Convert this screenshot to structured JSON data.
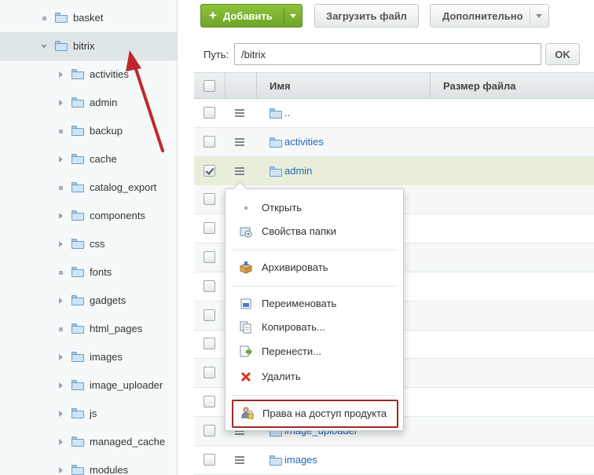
{
  "tree": {
    "items": [
      {
        "label": "basket",
        "control": "dot",
        "indent": 0,
        "selected": false
      },
      {
        "label": "bitrix",
        "control": "expanded",
        "indent": 0,
        "selected": true
      },
      {
        "label": "activities",
        "control": "collapsed",
        "indent": 1,
        "selected": false
      },
      {
        "label": "admin",
        "control": "collapsed",
        "indent": 1,
        "selected": false
      },
      {
        "label": "backup",
        "control": "dot",
        "indent": 1,
        "selected": false
      },
      {
        "label": "cache",
        "control": "collapsed",
        "indent": 1,
        "selected": false
      },
      {
        "label": "catalog_export",
        "control": "dot",
        "indent": 1,
        "selected": false
      },
      {
        "label": "components",
        "control": "collapsed",
        "indent": 1,
        "selected": false
      },
      {
        "label": "css",
        "control": "collapsed",
        "indent": 1,
        "selected": false
      },
      {
        "label": "fonts",
        "control": "dot",
        "indent": 1,
        "selected": false
      },
      {
        "label": "gadgets",
        "control": "collapsed",
        "indent": 1,
        "selected": false
      },
      {
        "label": "html_pages",
        "control": "dot",
        "indent": 1,
        "selected": false
      },
      {
        "label": "images",
        "control": "collapsed",
        "indent": 1,
        "selected": false
      },
      {
        "label": "image_uploader",
        "control": "collapsed",
        "indent": 1,
        "selected": false
      },
      {
        "label": "js",
        "control": "collapsed",
        "indent": 1,
        "selected": false
      },
      {
        "label": "managed_cache",
        "control": "collapsed",
        "indent": 1,
        "selected": false
      },
      {
        "label": "modules",
        "control": "collapsed",
        "indent": 1,
        "selected": false
      }
    ]
  },
  "toolbar": {
    "add_label": "Добавить",
    "upload_label": "Загрузить файл",
    "more_label": "Дополнительно",
    "path_label": "Путь:",
    "path_value": "/bitrix",
    "ok_label": "OK"
  },
  "grid": {
    "col_name": "Имя",
    "col_size": "Размер файла",
    "rows": [
      {
        "name": "..",
        "checked": false,
        "parent": true
      },
      {
        "name": "activities",
        "checked": false
      },
      {
        "name": "admin",
        "checked": true,
        "selected": true
      },
      {
        "name": "",
        "checked": false
      },
      {
        "name": "",
        "checked": false
      },
      {
        "name": "",
        "checked": false
      },
      {
        "name": "",
        "checked": false
      },
      {
        "name": "",
        "checked": false
      },
      {
        "name": "",
        "checked": false
      },
      {
        "name": "",
        "checked": false
      },
      {
        "name": "",
        "checked": false
      },
      {
        "name": "image_uploader",
        "checked": false
      },
      {
        "name": "images",
        "checked": false
      }
    ]
  },
  "context_menu": {
    "open": "Открыть",
    "folder_properties": "Свойства папки",
    "archive": "Архивировать",
    "rename": "Переименовать",
    "copy": "Копировать...",
    "move": "Перенести...",
    "delete": "Удалить",
    "access_rights": "Права на доступ продукта"
  },
  "colors": {
    "add_button": "#7ab432",
    "link": "#2067b0",
    "highlight_border": "#9c2a2a",
    "arrow": "#c0272d"
  },
  "icons": {
    "open": "bullet-icon",
    "folder_properties": "folder-properties-icon",
    "archive": "archive-box-icon",
    "rename": "rename-icon",
    "copy": "copy-icon",
    "move": "move-icon",
    "delete": "delete-cross-icon",
    "access_rights": "user-lock-icon"
  }
}
